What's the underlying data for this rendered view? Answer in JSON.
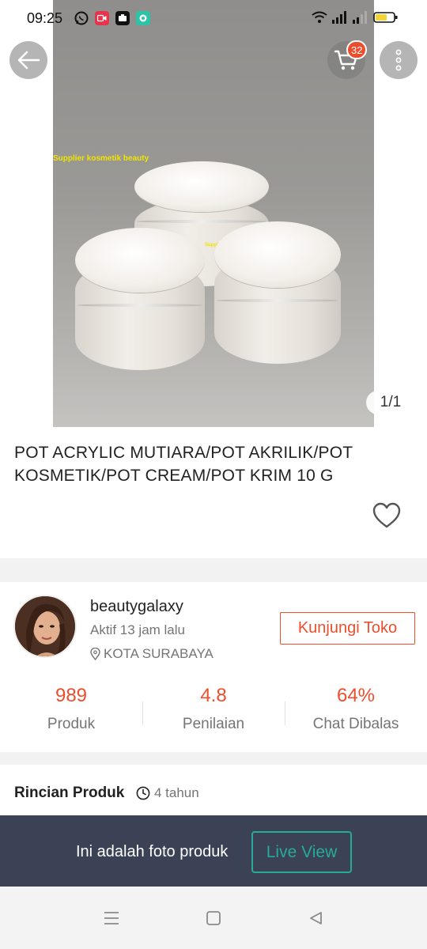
{
  "status_bar": {
    "time": "09:25",
    "left_icons": [
      "whatsapp-icon",
      "screen-record-icon",
      "notification-app-icon",
      "chat-app-icon"
    ],
    "right_icons": [
      "wifi-icon",
      "signal-icon",
      "signal-icon",
      "battery-icon"
    ]
  },
  "product": {
    "image_watermark": "Supplier kosmetik beauty",
    "image_watermark_small": "Supplier kosmetik beauty",
    "image_counter": "1/1",
    "cart_count": "32",
    "title": "POT ACRYLIC MUTIARA/POT AKRILIK/POT KOSMETIK/POT CREAM/POT KRIM 10 G"
  },
  "shop": {
    "name": "beautygalaxy",
    "active": "Aktif 13 jam lalu",
    "location": "KOTA SURABAYA",
    "visit_label": "Kunjungi Toko",
    "stats": [
      {
        "value": "989",
        "label": "Produk"
      },
      {
        "value": "4.8",
        "label": "Penilaian"
      },
      {
        "value": "64%",
        "label": "Chat Dibalas"
      }
    ]
  },
  "details": {
    "title": "Rincian Produk",
    "age": "4 tahun"
  },
  "banner": {
    "text": "Ini adalah foto produk",
    "button": "Live View"
  },
  "colors": {
    "accent": "#ee4d2d",
    "teal": "#26aa99",
    "banner_bg": "#3c4256"
  }
}
